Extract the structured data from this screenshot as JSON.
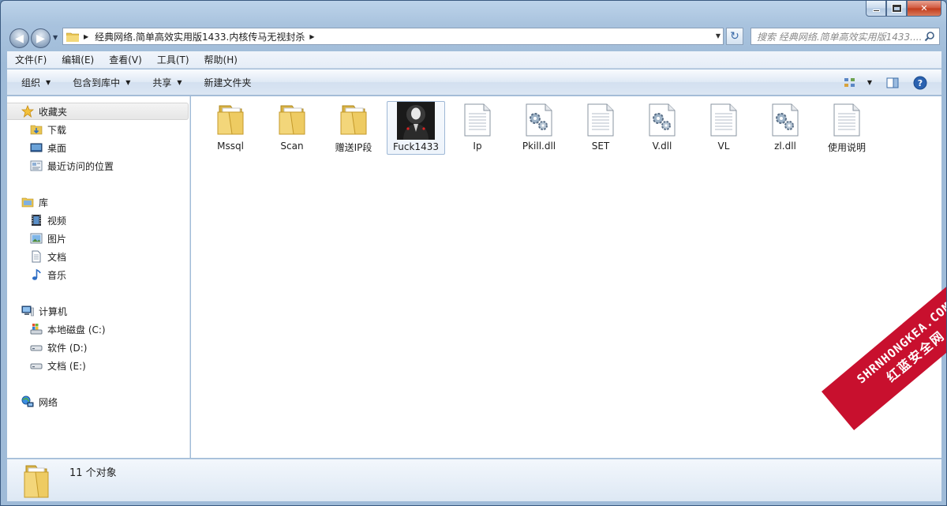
{
  "window": {
    "caption_buttons": {
      "minimize": "minimize",
      "maximize": "maximize",
      "close": "✕"
    }
  },
  "address": {
    "path": "经典网络.简单高效实用版1433.内核传马无视封杀",
    "search_placeholder": "搜索 经典网络.简单高效实用版1433...."
  },
  "menu": {
    "items": [
      "文件(F)",
      "编辑(E)",
      "查看(V)",
      "工具(T)",
      "帮助(H)"
    ]
  },
  "command_bar": {
    "organize": "组织",
    "include_library": "包含到库中",
    "share": "共享",
    "new_folder": "新建文件夹"
  },
  "nav": {
    "favorites": {
      "label": "收藏夹",
      "items": [
        "下载",
        "桌面",
        "最近访问的位置"
      ]
    },
    "libraries": {
      "label": "库",
      "items": [
        "视频",
        "图片",
        "文档",
        "音乐"
      ]
    },
    "computer": {
      "label": "计算机",
      "items": [
        "本地磁盘 (C:)",
        "软件 (D:)",
        "文档 (E:)"
      ]
    },
    "network": {
      "label": "网络"
    }
  },
  "files": [
    {
      "name": "Mssql",
      "type": "folder"
    },
    {
      "name": "Scan",
      "type": "folder"
    },
    {
      "name": "赠送IP段",
      "type": "folder"
    },
    {
      "name": "Fuck1433",
      "type": "exe-image"
    },
    {
      "name": "Ip",
      "type": "text"
    },
    {
      "name": "Pkill.dll",
      "type": "dll"
    },
    {
      "name": "SET",
      "type": "text"
    },
    {
      "name": "V.dll",
      "type": "dll"
    },
    {
      "name": "VL",
      "type": "text"
    },
    {
      "name": "zl.dll",
      "type": "dll"
    },
    {
      "name": "使用说明",
      "type": "text"
    }
  ],
  "status": {
    "count_text": "11 个对象"
  },
  "watermark": {
    "line1": "SHRNHONGKEA.COM",
    "line2": "红蓝安全网"
  }
}
